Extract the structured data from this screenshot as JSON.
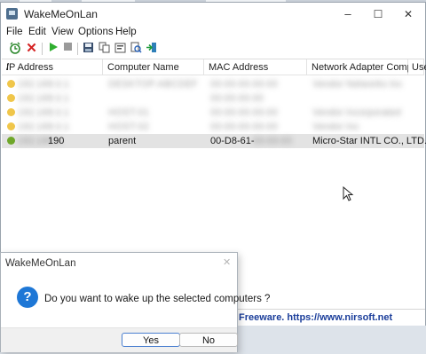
{
  "window": {
    "title": "WakeMeOnLan",
    "minimize": "–",
    "maximize": "☐",
    "close": "✕"
  },
  "menu": [
    "File",
    "Edit",
    "View",
    "Options",
    "Help"
  ],
  "table": {
    "columns": [
      "IP Address",
      "Computer Name",
      "MAC Address",
      "Network Adapter Comp...",
      "Use"
    ],
    "sort_indicator": "/",
    "rows": [
      {
        "ip": "",
        "name": "",
        "mac": "",
        "adapter": "",
        "status": "offline"
      },
      {
        "ip": "",
        "name": "",
        "mac": "",
        "adapter": "",
        "status": "offline"
      },
      {
        "ip": "",
        "name": "",
        "mac": "",
        "adapter": "",
        "status": "offline"
      },
      {
        "ip": "",
        "name": "",
        "mac": "",
        "adapter": "",
        "status": "offline"
      },
      {
        "ip": "190",
        "name": "parent",
        "mac": "00-D8-61-",
        "adapter": "Micro-Star INTL CO., LTD.",
        "status": "online",
        "selected": true
      }
    ]
  },
  "status_bar": {
    "text": "Freeware. https://www.nirsoft.net"
  },
  "dialog": {
    "title": "WakeMeOnLan",
    "message": "Do you want to wake up the selected computers ?",
    "yes_label": "Yes",
    "no_label": "No"
  },
  "colors": {
    "online": "#6fa72a",
    "offline": "#f0c64a",
    "link_blue": "#1a3d9a",
    "dialog_icon": "#1e77d6"
  }
}
